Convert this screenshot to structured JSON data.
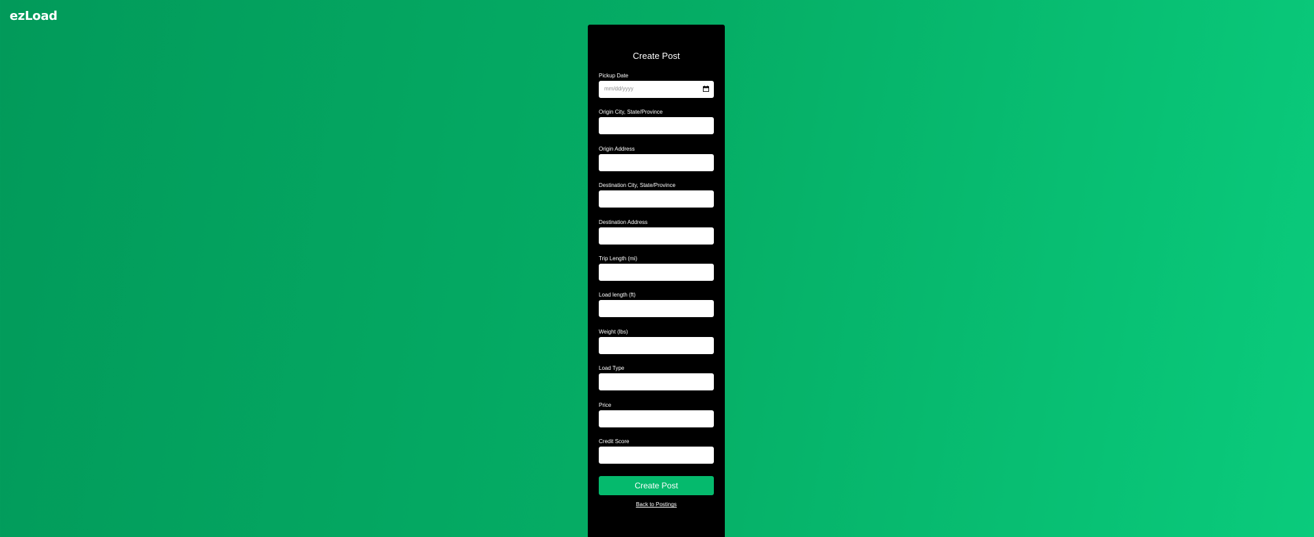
{
  "brand": {
    "name": "ezLoad"
  },
  "form": {
    "title": "Create Post",
    "fields": [
      {
        "label": "Pickup Date",
        "placeholder": "mm/dd/yyyy",
        "icon": "calendar-icon"
      },
      {
        "label": "Origin City, State/Province",
        "value": ""
      },
      {
        "label": "Origin Address",
        "value": ""
      },
      {
        "label": "Destination City, State/Province",
        "value": ""
      },
      {
        "label": "Destination Address",
        "value": ""
      },
      {
        "label": "Trip Length (mi)",
        "value": ""
      },
      {
        "label": "Load length (ft)",
        "value": ""
      },
      {
        "label": "Weight (lbs)",
        "value": ""
      },
      {
        "label": "Load Type",
        "value": ""
      },
      {
        "label": "Price",
        "value": ""
      },
      {
        "label": "Credit Score",
        "value": ""
      }
    ],
    "submit_label": "Create Post",
    "back_link": "Back to Postings"
  },
  "colors": {
    "background_start": "#029a5a",
    "background_end": "#0acb7c",
    "panel": "#000000",
    "button": "#05ba6d"
  }
}
